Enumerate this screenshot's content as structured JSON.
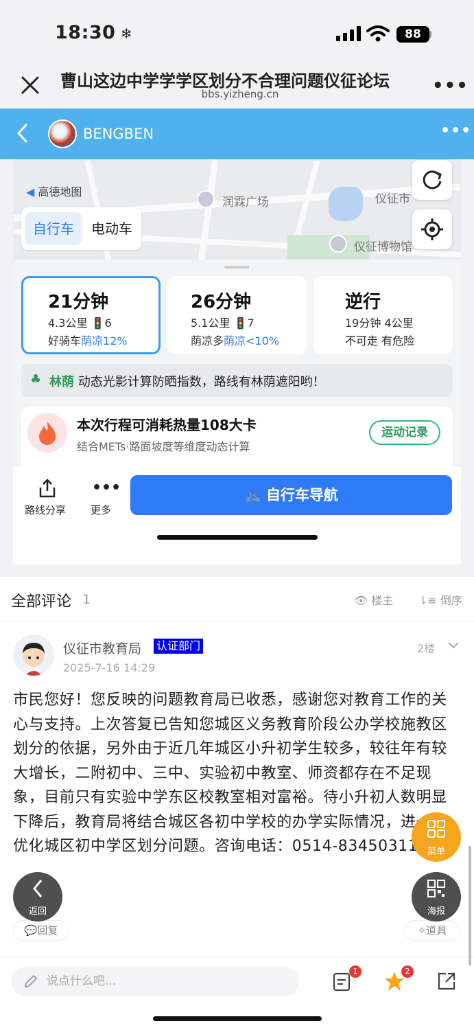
{
  "status": {
    "time": "18:30",
    "battery": "88"
  },
  "header": {
    "title": "曹山这边中学学学区划分不合理问题仪征论坛",
    "domain": "bbs.yizheng.cn"
  },
  "poster": {
    "name": "BENGBEN"
  },
  "map": {
    "logo": "高德地图",
    "labels": {
      "plaza": "润霖广场",
      "city": "仪征市",
      "museum": "仪征博物馆"
    },
    "modes": [
      "自行车",
      "电动车"
    ]
  },
  "routes": [
    {
      "time": "21分钟",
      "line1": "4.3公里 🚦6",
      "line2a": "好骑车",
      "line2b": "荫凉12%"
    },
    {
      "time": "26分钟",
      "line1": "5.1公里 🚦7",
      "line2a": "荫凉多",
      "line2b": "荫凉<10%"
    },
    {
      "time": "逆行",
      "line1": "19分钟 4公里",
      "line2a": "不可走 有危险",
      "line2b": ""
    }
  ],
  "tip": {
    "tag": "林荫",
    "text": "动态光影计算防晒指数，路线有林荫遮阳哟！"
  },
  "calorie": {
    "title": "本次行程可消耗热量108大卡",
    "sub": "结合METs·路面坡度等维度动态计算",
    "button": "运动记录"
  },
  "nav": {
    "share": "路线分享",
    "more": "更多",
    "go": "自行车导航"
  },
  "comments": {
    "title": "全部评论",
    "count": "1",
    "only_op": "楼主",
    "order": "倒序",
    "items": [
      {
        "author": "仪征市教育局",
        "badge": "认证部门",
        "floor": "2楼",
        "date": "2025-7-16 14:29",
        "body": "市民您好！您反映的问题教育局已收悉，感谢您对教育工作的关心与支持。上次答复已告知您城区义务教育阶段公办学校施教区划分的依据，另外由于近几年城区小升初学生较多，较往年有较大增长，二附初中、三中、实验初中教室、师资都存在不足现象，目前只有实验中学东区校教室相对富裕。待小升初人数明显下降后，教育局将结合城区各初中学校的办学实际情况，进一步优化城区初中学区划分问题。咨询电话：0514-83450311",
        "reply": "回复",
        "tools": "道具"
      }
    ]
  },
  "footer": {
    "placeholder": "说点什么吧...",
    "badge_comments": "1",
    "badge_fav": "2"
  },
  "float": {
    "menu": "菜单",
    "back": "返回",
    "poster": "海报"
  },
  "colors": {
    "accent": "#2f7bf6",
    "header": "#4fb2ee",
    "menu": "#f7a51c"
  }
}
